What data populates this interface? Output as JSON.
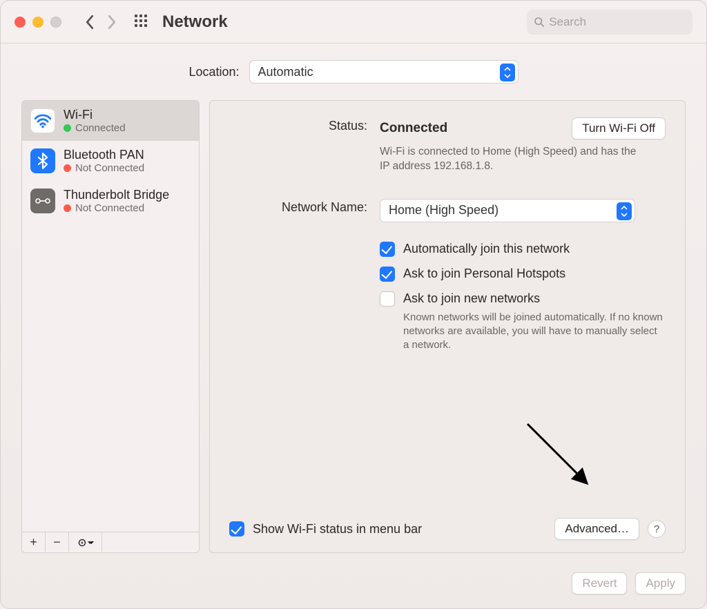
{
  "header": {
    "title": "Network",
    "search_placeholder": "Search"
  },
  "location": {
    "label": "Location:",
    "value": "Automatic"
  },
  "sidebar": {
    "items": [
      {
        "name": "Wi-Fi",
        "status": "Connected",
        "dot": "green",
        "icon": "wifi",
        "selected": true
      },
      {
        "name": "Bluetooth PAN",
        "status": "Not Connected",
        "dot": "red",
        "icon": "bluetooth",
        "selected": false
      },
      {
        "name": "Thunderbolt Bridge",
        "status": "Not Connected",
        "dot": "red",
        "icon": "bridge",
        "selected": false
      }
    ],
    "tools": {
      "add": "+",
      "remove": "−",
      "more": "⊙"
    }
  },
  "detail": {
    "status_label": "Status:",
    "status_value": "Connected",
    "toggle_label": "Turn Wi-Fi Off",
    "status_desc": "Wi-Fi is connected to Home (High Speed) and has the IP address 192.168.1.8.",
    "network_name_label": "Network Name:",
    "network_name_value": "Home (High Speed)",
    "checks": {
      "auto_join": {
        "label": "Automatically join this network",
        "checked": true
      },
      "ask_hotspot": {
        "label": "Ask to join Personal Hotspots",
        "checked": true
      },
      "ask_new": {
        "label": "Ask to join new networks",
        "checked": false,
        "desc": "Known networks will be joined automatically. If no known networks are available, you will have to manually select a network."
      }
    },
    "show_menubar": {
      "label": "Show Wi-Fi status in menu bar",
      "checked": true
    },
    "advanced_label": "Advanced…",
    "help_label": "?"
  },
  "footer": {
    "revert": "Revert",
    "apply": "Apply"
  }
}
